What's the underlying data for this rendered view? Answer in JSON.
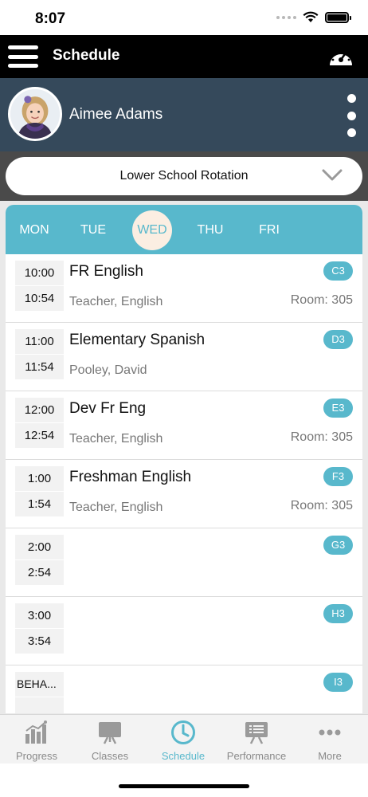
{
  "status": {
    "time": "8:07"
  },
  "header": {
    "title": "Schedule",
    "menu_icon": "hamburger-icon",
    "dashboard_icon": "speedometer-icon"
  },
  "profile": {
    "name": "Aimee Adams",
    "avatar": "student-photo",
    "more_icon": "kebab-icon"
  },
  "rotation": {
    "label": "Lower School Rotation",
    "icon": "chevron-down-icon"
  },
  "days": {
    "items": [
      "MON",
      "TUE",
      "WED",
      "THU",
      "FRI"
    ],
    "selected": "WED"
  },
  "periods": [
    {
      "start": "10:00",
      "end": "10:54",
      "title": "FR English",
      "teacher": "Teacher, English",
      "room": "Room: 305",
      "block": "C3"
    },
    {
      "start": "11:00",
      "end": "11:54",
      "title": "Elementary Spanish",
      "teacher": "Pooley, David",
      "room": "",
      "block": "D3"
    },
    {
      "start": "12:00",
      "end": "12:54",
      "title": "Dev Fr Eng",
      "teacher": "Teacher, English",
      "room": "Room: 305",
      "block": "E3"
    },
    {
      "start": "1:00",
      "end": "1:54",
      "title": "Freshman English",
      "teacher": "Teacher, English",
      "room": "Room: 305",
      "block": "F3"
    },
    {
      "start": "2:00",
      "end": "2:54",
      "title": "",
      "teacher": "",
      "room": "",
      "block": "G3"
    },
    {
      "start": "3:00",
      "end": "3:54",
      "title": "",
      "teacher": "",
      "room": "",
      "block": "H3"
    },
    {
      "start": "BEHA...",
      "end": "",
      "title": "",
      "teacher": "",
      "room": "",
      "block": "I3"
    }
  ],
  "tabs": [
    {
      "label": "Progress",
      "icon": "bar-chart-icon"
    },
    {
      "label": "Classes",
      "icon": "easel-board-icon"
    },
    {
      "label": "Schedule",
      "icon": "clock-icon"
    },
    {
      "label": "Performance",
      "icon": "presentation-board-icon"
    },
    {
      "label": "More",
      "icon": "more-dots-icon"
    }
  ],
  "colors": {
    "accent": "#58b8cc",
    "header": "#000000",
    "profile_bg": "#35495b",
    "selected_day_bg": "#fbeee2"
  }
}
